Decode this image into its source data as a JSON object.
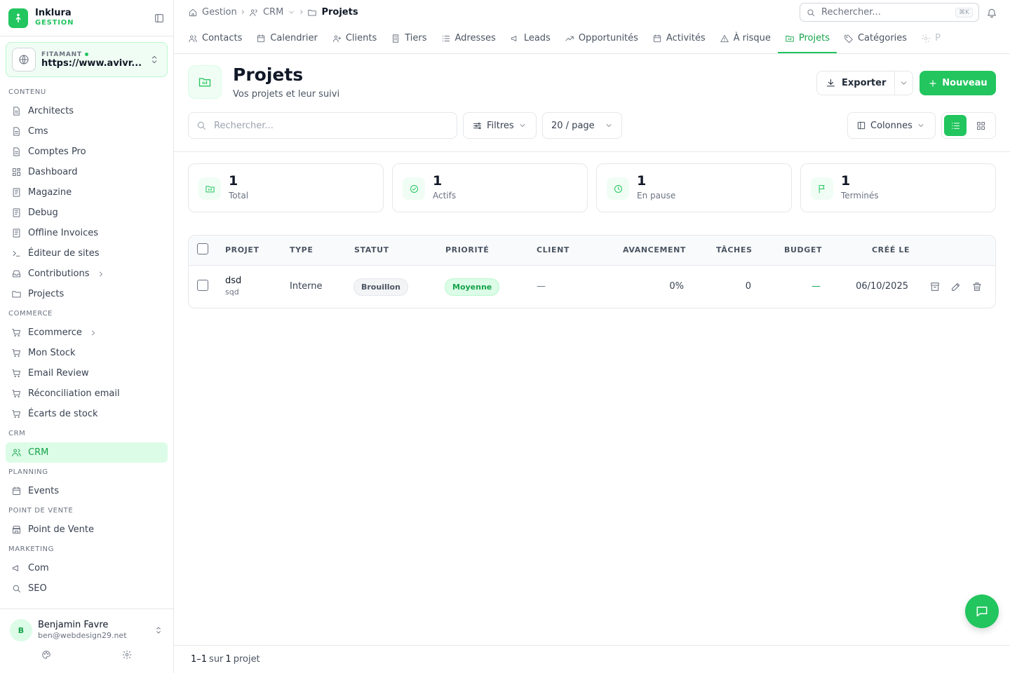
{
  "brand": {
    "name": "Inklura",
    "sub": "GESTION"
  },
  "site": {
    "label": "FITAMANT",
    "url": "https://www.avivr..."
  },
  "sidebar": {
    "sections": [
      {
        "title": "CONTENU",
        "items": [
          {
            "label": "Architects",
            "icon": "document-icon"
          },
          {
            "label": "Cms",
            "icon": "document-icon"
          },
          {
            "label": "Comptes Pro",
            "icon": "document-icon"
          },
          {
            "label": "Dashboard",
            "icon": "dashboard-icon"
          },
          {
            "label": "Magazine",
            "icon": "book-icon"
          },
          {
            "label": "Debug",
            "icon": "book-icon"
          },
          {
            "label": "Offline Invoices",
            "icon": "book-icon"
          },
          {
            "label": "Éditeur de sites",
            "icon": "terminal-icon"
          },
          {
            "label": "Contributions",
            "icon": "inbox-icon"
          },
          {
            "label": "Projects",
            "icon": "folder-icon"
          }
        ]
      },
      {
        "title": "COMMERCE",
        "items": [
          {
            "label": "Ecommerce",
            "icon": "cart-icon"
          },
          {
            "label": "Mon Stock",
            "icon": "cart-icon"
          },
          {
            "label": "Email Review",
            "icon": "cart-icon"
          },
          {
            "label": "Réconciliation email",
            "icon": "cart-icon"
          },
          {
            "label": "Écarts de stock",
            "icon": "cart-icon"
          }
        ]
      },
      {
        "title": "CRM",
        "items": [
          {
            "label": "CRM",
            "icon": "users-icon"
          }
        ]
      },
      {
        "title": "PLANNING",
        "items": [
          {
            "label": "Events",
            "icon": "calendar-icon"
          }
        ]
      },
      {
        "title": "POINT DE VENTE",
        "items": [
          {
            "label": "Point de Vente",
            "icon": "store-icon"
          }
        ]
      },
      {
        "title": "MARKETING",
        "items": [
          {
            "label": "Com",
            "icon": "megaphone-icon"
          },
          {
            "label": "SEO",
            "icon": "search-icon"
          }
        ]
      }
    ]
  },
  "user": {
    "initial": "B",
    "name": "Benjamin Favre",
    "email": "ben@webdesign29.net"
  },
  "breadcrumb": {
    "home": "Gestion",
    "parent": "CRM",
    "current": "Projets"
  },
  "top_search": {
    "placeholder": "Rechercher...",
    "shortcut": "⌘K"
  },
  "tabs": [
    {
      "label": "Contacts",
      "icon": "users-icon"
    },
    {
      "label": "Calendrier",
      "icon": "calendar-icon"
    },
    {
      "label": "Clients",
      "icon": "user-plus-icon"
    },
    {
      "label": "Tiers",
      "icon": "building-icon"
    },
    {
      "label": "Adresses",
      "icon": "list-icon"
    },
    {
      "label": "Leads",
      "icon": "megaphone-icon"
    },
    {
      "label": "Opportunités",
      "icon": "trend-icon"
    },
    {
      "label": "Activités",
      "icon": "calendar-icon"
    },
    {
      "label": "À risque",
      "icon": "warning-icon"
    },
    {
      "label": "Projets",
      "icon": "folder-icon",
      "active": true
    },
    {
      "label": "Catégories",
      "icon": "tag-icon"
    },
    {
      "label": "P",
      "icon": "gear-icon"
    }
  ],
  "page": {
    "title": "Projets",
    "subtitle": "Vos projets et leur suivi"
  },
  "actions": {
    "export": "Exporter",
    "new": "Nouveau"
  },
  "toolbar": {
    "search_placeholder": "Rechercher...",
    "filters": "Filtres",
    "page_size": "20 / page",
    "columns": "Colonnes"
  },
  "stats": [
    {
      "value": "1",
      "label": "Total",
      "icon": "folder-icon"
    },
    {
      "value": "1",
      "label": "Actifs",
      "icon": "check-circle-icon"
    },
    {
      "value": "1",
      "label": "En pause",
      "icon": "clock-icon"
    },
    {
      "value": "1",
      "label": "Terminés",
      "icon": "flag-icon"
    }
  ],
  "table": {
    "headers": [
      "PROJET",
      "TYPE",
      "STATUT",
      "PRIORITÉ",
      "CLIENT",
      "AVANCEMENT",
      "TÂCHES",
      "BUDGET",
      "CRÉÉ LE"
    ],
    "rows": [
      {
        "name": "dsd",
        "sub": "sqd",
        "type": "Interne",
        "status": "Brouillon",
        "priority": "Moyenne",
        "client": "—",
        "progress": "0%",
        "tasks": "0",
        "budget": "—",
        "created": "06/10/2025"
      }
    ]
  },
  "footer": {
    "range": "1–1",
    "of": "sur",
    "count": "1",
    "unit": "projet"
  },
  "colors": {
    "accent": "#22c55e",
    "accent_dark": "#16a34a",
    "accent_light": "#dcfce7"
  }
}
